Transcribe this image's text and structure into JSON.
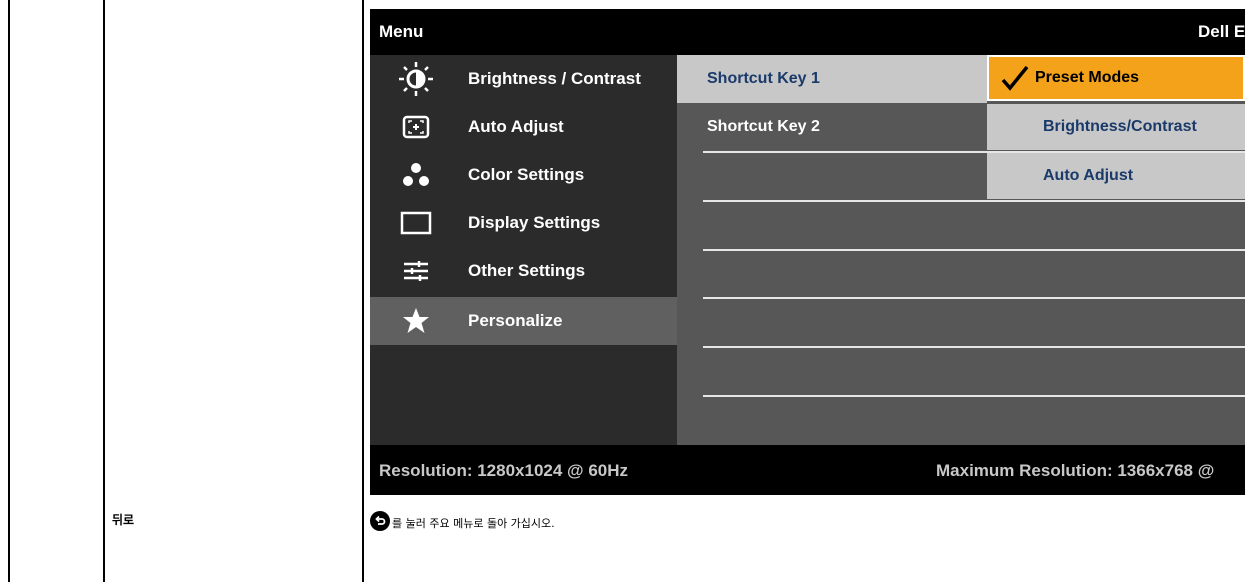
{
  "osd": {
    "title": "Menu",
    "brand": "Dell E",
    "menu_items": [
      {
        "label": "Brightness / Contrast",
        "icon": "brightness-icon"
      },
      {
        "label": "Auto Adjust",
        "icon": "auto-adjust-icon"
      },
      {
        "label": "Color Settings",
        "icon": "color-settings-icon"
      },
      {
        "label": "Display Settings",
        "icon": "display-settings-icon"
      },
      {
        "label": "Other Settings",
        "icon": "other-settings-icon"
      },
      {
        "label": "Personalize",
        "icon": "star-icon",
        "selected": true
      }
    ],
    "submenu": [
      {
        "label": "Shortcut Key 1",
        "selected": true
      },
      {
        "label": "Shortcut Key 2"
      }
    ],
    "options": [
      {
        "label": "Preset Modes",
        "active": true
      },
      {
        "label": "Brightness/Contrast"
      },
      {
        "label": "Auto Adjust"
      }
    ],
    "footer": {
      "resolution": "Resolution: 1280x1024 @ 60Hz",
      "max_resolution": "Maximum Resolution: 1366x768 @"
    },
    "colors": {
      "accent": "#f4a21a",
      "highlight": "#c8c8c8",
      "menu_bg": "#2b2b2b",
      "content_bg": "#575757"
    }
  },
  "doc": {
    "label": "뒤로",
    "description": "를 눌러 주요 메뉴로 돌아 가십시오.",
    "icon": "back-icon"
  }
}
